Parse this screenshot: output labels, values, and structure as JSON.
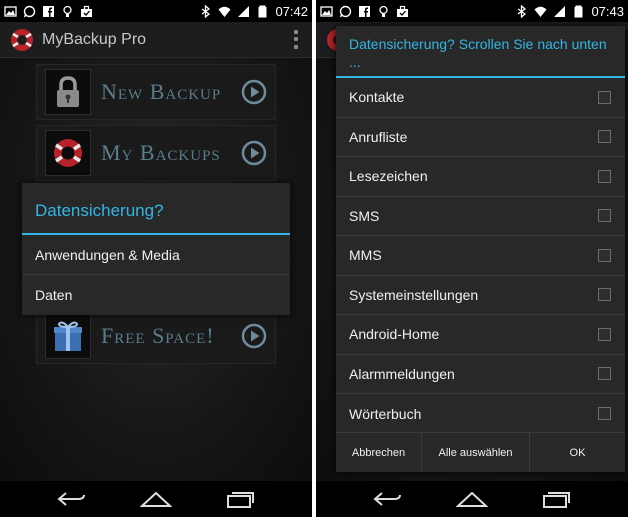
{
  "left": {
    "status": {
      "time": "07:42"
    },
    "action_bar": {
      "title": "MyBackup Pro"
    },
    "tiles": [
      {
        "label": "New Backup",
        "icon": "lock-icon"
      },
      {
        "label": "My Backups",
        "icon": "life-ring-icon"
      },
      {
        "label": "Free Space!",
        "icon": "gift-icon"
      }
    ],
    "dialog": {
      "title": "Datensicherung?",
      "items": [
        "Anwendungen & Media",
        "Daten"
      ]
    }
  },
  "right": {
    "status": {
      "time": "07:43"
    },
    "dialog": {
      "title": "Datensicherung? Scrollen Sie nach unten ...",
      "items": [
        {
          "label": "Kontakte",
          "checked": false
        },
        {
          "label": "Anrufliste",
          "checked": false
        },
        {
          "label": "Lesezeichen",
          "checked": false
        },
        {
          "label": "SMS",
          "checked": false
        },
        {
          "label": "MMS",
          "checked": false
        },
        {
          "label": "Systemeinstellungen",
          "checked": false
        },
        {
          "label": "Android-Home",
          "checked": false
        },
        {
          "label": "Alarmmeldungen",
          "checked": false
        },
        {
          "label": "Wörterbuch",
          "checked": false
        }
      ],
      "buttons": [
        "Abbrechen",
        "Alle auswählen",
        "OK"
      ]
    }
  },
  "colors": {
    "accent": "#33b5e5",
    "tile_text": "#5a7d8c",
    "dialog_bg": "#282828"
  }
}
